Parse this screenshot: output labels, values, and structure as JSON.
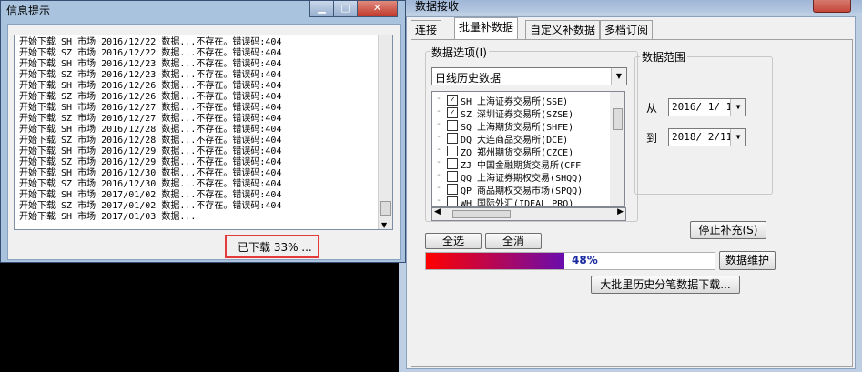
{
  "back_window": {
    "title": "数据接收",
    "tabs": [
      {
        "label": "连接"
      },
      {
        "label": "批量补数据"
      },
      {
        "label": "自定义补数据"
      },
      {
        "label": "多档订阅"
      }
    ],
    "data_options": {
      "label": "数据选项(I)",
      "selected_type": "日线历史数据",
      "markets": [
        {
          "text": "SH 上海证券交易所(SSE)",
          "checked": true
        },
        {
          "text": "SZ 深圳证券交易所(SZSE)",
          "checked": true
        },
        {
          "text": "SQ 上海期货交易所(SHFE)",
          "checked": false
        },
        {
          "text": "DQ 大连商品交易所(DCE)",
          "checked": false
        },
        {
          "text": "ZQ 郑州期货交易所(CZCE)",
          "checked": false
        },
        {
          "text": "ZJ 中国金融期货交易所(CFF",
          "checked": false
        },
        {
          "text": "QQ 上海证券期权交易(SHQQ)",
          "checked": false
        },
        {
          "text": "QP 商品期权交易市场(SPQQ)",
          "checked": false
        },
        {
          "text": "WH 国际外汇(IDEAL PRO)",
          "checked": false
        }
      ]
    },
    "data_range": {
      "label": "数据范围",
      "from_label": "从",
      "from_date": "2016/ 1/ 1",
      "to_label": "到",
      "to_date": "2018/ 2/11"
    },
    "buttons": {
      "select_all": "全选",
      "deselect_all": "全消",
      "stop": "停止补充(S)",
      "maintain": "数据维护",
      "bulk_download": "大批里历史分笔数据下载..."
    },
    "progress": {
      "value": 48,
      "label": "48%"
    }
  },
  "front_window": {
    "title": "信息提示",
    "log_lines": [
      "开始下载 SH 市场 2016/12/22 数据...不存在。错误码:404",
      "开始下载 SZ 市场 2016/12/22 数据...不存在。错误码:404",
      "开始下载 SH 市场 2016/12/23 数据...不存在。错误码:404",
      "开始下载 SZ 市场 2016/12/23 数据...不存在。错误码:404",
      "开始下载 SH 市场 2016/12/26 数据...不存在。错误码:404",
      "开始下载 SZ 市场 2016/12/26 数据...不存在。错误码:404",
      "开始下载 SH 市场 2016/12/27 数据...不存在。错误码:404",
      "开始下载 SZ 市场 2016/12/27 数据...不存在。错误码:404",
      "开始下载 SH 市场 2016/12/28 数据...不存在。错误码:404",
      "开始下载 SZ 市场 2016/12/28 数据...不存在。错误码:404",
      "开始下载 SH 市场 2016/12/29 数据...不存在。错误码:404",
      "开始下载 SZ 市场 2016/12/29 数据...不存在。错误码:404",
      "开始下载 SH 市场 2016/12/30 数据...不存在。错误码:404",
      "开始下载 SZ 市场 2016/12/30 数据...不存在。错误码:404",
      "开始下载 SH 市场 2017/01/02 数据...不存在。错误码:404",
      "开始下载 SZ 市场 2017/01/02 数据...不存在。错误码:404",
      "开始下载 SH 市场 2017/01/03 数据..."
    ],
    "status": "已下载 33% ..."
  },
  "colors": {
    "progress_start": "#ff0000",
    "progress_end": "#6a0dad",
    "highlight_border": "#e33b3b"
  }
}
